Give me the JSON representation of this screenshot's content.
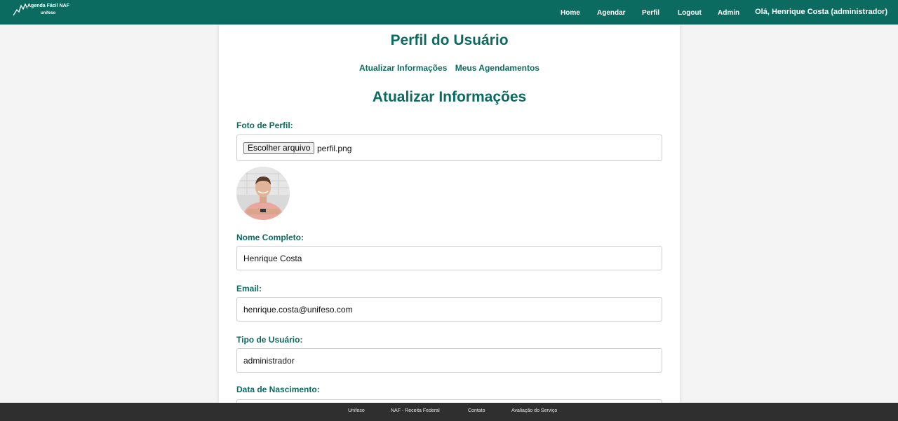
{
  "brand": {
    "name": "Agenda Fácil NAF",
    "sub": "unifeso"
  },
  "nav": {
    "items": [
      "Home",
      "Agendar",
      "Perfil",
      "Logout",
      "Admin"
    ],
    "greeting": "Olá, Henrique Costa (administrador)"
  },
  "page": {
    "title": "Perfil do Usuário",
    "subnav": [
      "Atualizar Informações",
      "Meus Agendamentos"
    ],
    "section_title": "Atualizar Informações"
  },
  "form": {
    "photo_label": "Foto de Perfil:",
    "file_button": "Escolher arquivo",
    "file_name": "perfil.png",
    "name_label": "Nome Completo:",
    "name_value": "Henrique Costa",
    "email_label": "Email:",
    "email_value": "henrique.costa@unifeso.com",
    "type_label": "Tipo de Usuário:",
    "type_value": "administrador",
    "birth_label": "Data de Nascimento:"
  },
  "footer": {
    "links": [
      "Unifeso",
      "NAF - Receita Federal",
      "Contato",
      "Avaliação do Serviço"
    ]
  },
  "colors": {
    "primary": "#0c6b61",
    "footer": "#2f2f2f",
    "background": "#f4f4f4"
  }
}
